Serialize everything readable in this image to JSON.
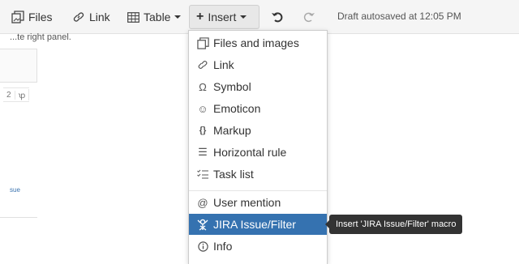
{
  "toolbar": {
    "files_label": "Files",
    "link_label": "Link",
    "table_label": "Table",
    "insert_label": "Insert",
    "draft_status": "Draft autosaved at 12:05 PM"
  },
  "background": {
    "partial_text": "...te right panel.",
    "table_cells": [
      "2",
      "ꝕ"
    ],
    "partial_link": "sue"
  },
  "insert_menu": {
    "items": [
      {
        "label": "Files and images",
        "icon": "files-images-icon"
      },
      {
        "label": "Link",
        "icon": "link-icon"
      },
      {
        "label": "Symbol",
        "icon": "omega-icon"
      },
      {
        "label": "Emoticon",
        "icon": "smiley-icon"
      },
      {
        "label": "Markup",
        "icon": "braces-icon"
      },
      {
        "label": "Horizontal rule",
        "icon": "horizontal-rule-icon"
      },
      {
        "label": "Task list",
        "icon": "task-list-icon"
      },
      {
        "label": "User mention",
        "icon": "at-icon"
      },
      {
        "label": "JIRA Issue/Filter",
        "icon": "jira-icon"
      },
      {
        "label": "Info",
        "icon": "info-icon"
      }
    ],
    "active_item": "JIRA Issue/Filter"
  },
  "tooltip": {
    "text": "Insert 'JIRA Issue/Filter' macro"
  },
  "colors": {
    "highlight": "#3572b0",
    "tooltip_bg": "#333333",
    "toolbar_bg": "#f5f5f5"
  }
}
